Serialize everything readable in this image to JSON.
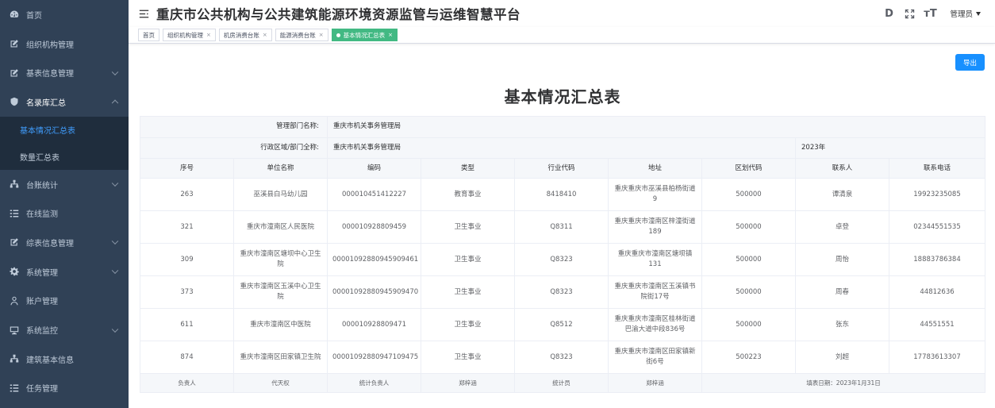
{
  "sidebar": {
    "items": [
      {
        "label": "首页",
        "icon": "dashboard-icon"
      },
      {
        "label": "组织机构管理",
        "icon": "edit-icon"
      },
      {
        "label": "基表信息管理",
        "icon": "edit-icon"
      },
      {
        "label": "名录库汇总",
        "icon": "shield-icon"
      },
      {
        "label": "台账统计",
        "icon": "tree-icon"
      },
      {
        "label": "在线监测",
        "icon": "list-icon"
      },
      {
        "label": "综表信息管理",
        "icon": "edit-icon"
      },
      {
        "label": "系统管理",
        "icon": "gear-icon"
      },
      {
        "label": "账户管理",
        "icon": "user-icon"
      },
      {
        "label": "系统监控",
        "icon": "monitor-icon"
      },
      {
        "label": "建筑基本信息",
        "icon": "tree-icon"
      },
      {
        "label": "任务管理",
        "icon": "list-icon"
      }
    ],
    "sub_items": [
      {
        "label": "基本情况汇总表",
        "active": true
      },
      {
        "label": "数量汇总表",
        "active": false
      }
    ]
  },
  "header": {
    "title": "重庆市公共机构与公共建筑能源环境资源监管与运维智慧平台",
    "doc_icon_letter": "D",
    "font_icon_label": "тT",
    "user": "管理员"
  },
  "tags": [
    {
      "label": "首页",
      "closable": false,
      "active": false
    },
    {
      "label": "组织机构管理",
      "closable": true,
      "active": false
    },
    {
      "label": "机房消费台账",
      "closable": true,
      "active": false
    },
    {
      "label": "能源消费台账",
      "closable": true,
      "active": false
    },
    {
      "label": "基本情况汇总表",
      "closable": true,
      "active": true
    }
  ],
  "main": {
    "export_label": "导出",
    "page_title": "基本情况汇总表",
    "info": {
      "dept_label": "管理部门名称:",
      "dept_value": "重庆市机关事务管理局",
      "region_label": "行政区域/部门全称:",
      "region_value": "重庆市机关事务管理局",
      "year": "2023年"
    },
    "columns": [
      "序号",
      "单位名称",
      "编码",
      "类型",
      "行业代码",
      "地址",
      "区划代码",
      "联系人",
      "联系电话"
    ],
    "rows": [
      [
        "263",
        "巫溪县白马幼儿园",
        "000010451412227",
        "教育事业",
        "8418410",
        "重庆重庆市巫溪县柏杨街道9",
        "500000",
        "谭清泉",
        "19923235085"
      ],
      [
        "321",
        "重庆市潼南区人民医院",
        "000010928809459",
        "卫生事业",
        "Q8311",
        "重庆重庆市潼南区梓潼街道189",
        "500000",
        "卓登",
        "02344551535"
      ],
      [
        "309",
        "重庆市潼南区塘坝中心卫生院",
        "00001092880945909461",
        "卫生事业",
        "Q8323",
        "重庆重庆市潼南区塘坝镇131",
        "500000",
        "周怡",
        "18883786384"
      ],
      [
        "373",
        "重庆市潼南区玉溪中心卫生院",
        "00001092880945909470",
        "卫生事业",
        "Q8323",
        "重庆重庆市潼南区玉溪镇书院街17号",
        "500000",
        "周春",
        "44812636"
      ],
      [
        "611",
        "重庆市潼南区中医院",
        "000010928809471",
        "卫生事业",
        "Q8512",
        "重庆重庆市潼南区桂林街道巴渝大道中段836号",
        "500000",
        "张东",
        "44551551"
      ],
      [
        "874",
        "重庆市潼南区田家镇卫生院",
        "00001092880947109475",
        "卫生事业",
        "Q8323",
        "重庆重庆市潼南区田家镇新街6号",
        "500223",
        "刘超",
        "17783613307"
      ]
    ],
    "footer": {
      "c1": "负责人",
      "c2": "代天权",
      "c3": "统计负责人",
      "c4": "郑梓涵",
      "c5": "统计员",
      "c6": "郑梓涵",
      "c7": "填表日期：2023年1月31日"
    }
  },
  "colors": {
    "sidebar_bg": "#304156",
    "submenu_bg": "#1f2d3d",
    "active_link": "#409eff",
    "active_tag": "#42b983",
    "export_button": "#1890ff"
  }
}
